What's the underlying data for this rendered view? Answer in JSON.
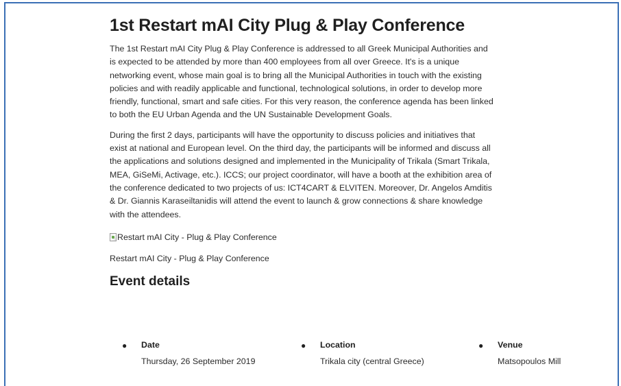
{
  "article": {
    "title": "1st Restart mAI City Plug & Play Conference",
    "paragraphs": [
      "The 1st Restart mAI City Plug & Play Conference is addressed to all Greek Municipal Authorities and is expected to be attended by more than 400 employees from all over Greece. It's is a unique networking event, whose main goal is to bring all the Municipal Authorities in touch with the existing policies and with readily applicable and functional, technological solutions, in order to develop more friendly, functional, smart and safe cities. For this very reason, the conference agenda has been linked to both the EU Urban Agenda and the UN Sustainable Development Goals.",
      "During the first 2 days, participants will have the opportunity to discuss policies and initiatives that exist at national and European level. On the third day, the participants will be informed and discuss all the applications and solutions designed and implemented in the Municipality of Trikala (Smart Trikala, MEA, GiSeMi, Activage, etc.). ICCS; our project coordinator, will have a booth at the exhibition area of the conference dedicated to two projects of us: ICT4CART & ELVITEN. Moreover, Dr. Angelos Amditis & Dr. Giannis Karaseiltanidis will attend the event to launch & grow connections & share knowledge with the attendees."
    ],
    "image_alt": "Restart mAI City - Plug & Play Conference",
    "caption": "Restart mAI City - Plug & Play Conference"
  },
  "event_details": {
    "heading": "Event details",
    "items": [
      {
        "label": "Date",
        "value": "Thursday, 26 September 2019"
      },
      {
        "label": "Location",
        "value": "Trikala city (central Greece)"
      },
      {
        "label": "Venue",
        "value": "Matsopoulos Mill"
      }
    ]
  },
  "colors": {
    "frame_border": "#3a6fb5",
    "text": "#2b2b2b",
    "heading": "#1f1f1f"
  },
  "icons": {
    "broken_image": "broken-image-icon",
    "bullet": "bullet-icon"
  }
}
